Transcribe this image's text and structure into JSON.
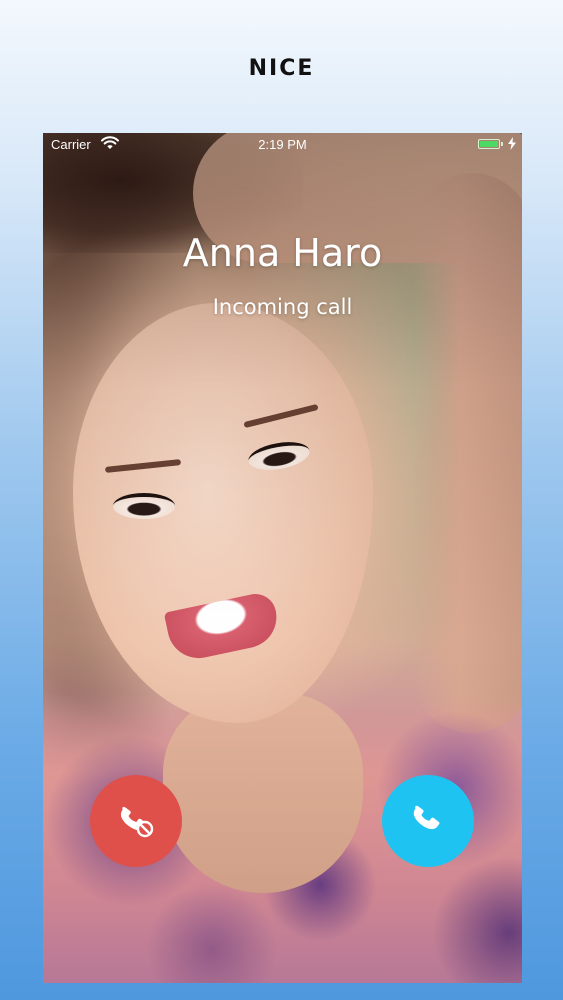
{
  "app": {
    "title": "NICE"
  },
  "status_bar": {
    "carrier": "Carrier",
    "time": "2:19 PM",
    "battery_level": 1.0,
    "charging": true
  },
  "call": {
    "caller_name": "Anna Haro",
    "status_text": "Incoming call"
  },
  "buttons": {
    "decline": {
      "icon": "phone-decline-icon",
      "color": "#e0504a"
    },
    "accept": {
      "icon": "phone-accept-icon",
      "color": "#1ec3f2"
    }
  },
  "colors": {
    "battery": "#4cd964",
    "text": "#ffffff",
    "background_top": "#f3f8fd",
    "background_bottom": "#4f98de"
  }
}
